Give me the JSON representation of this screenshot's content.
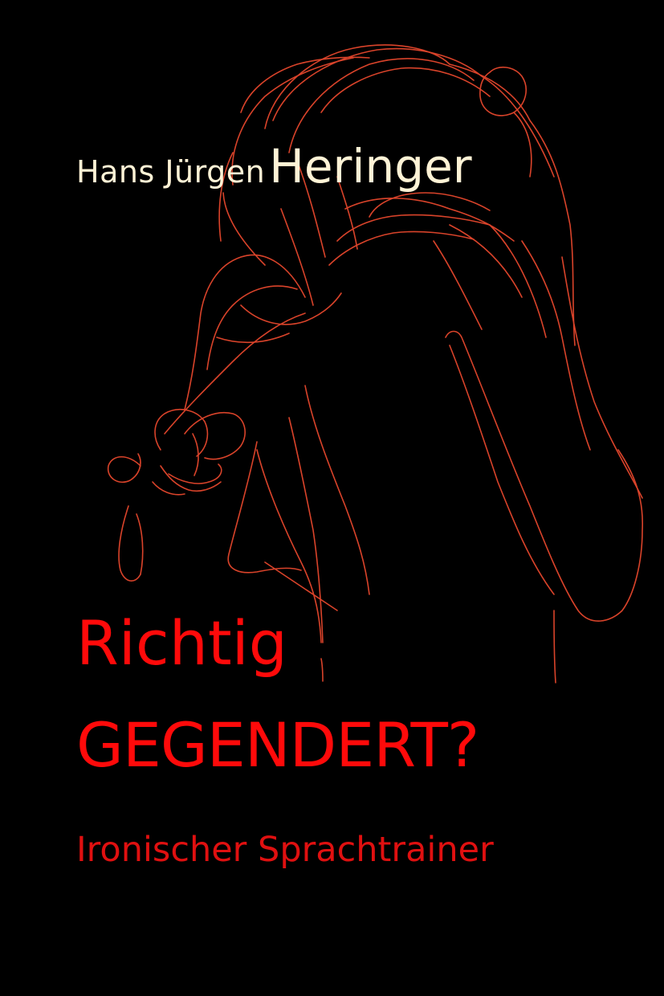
{
  "cover": {
    "background_color": "#000000",
    "line_color": "#d9432a"
  },
  "author": {
    "given_names": "Hans Jürgen",
    "family_name": "Heringer",
    "color": "#fff3d6"
  },
  "title": {
    "line1": "Richtig",
    "line2": "GEGENDERT?",
    "color": "#ff0a0a"
  },
  "subtitle": {
    "text": "Ironischer Sprachtrainer"
  },
  "illustration": {
    "icon": "line-drawing-figure-icon"
  }
}
